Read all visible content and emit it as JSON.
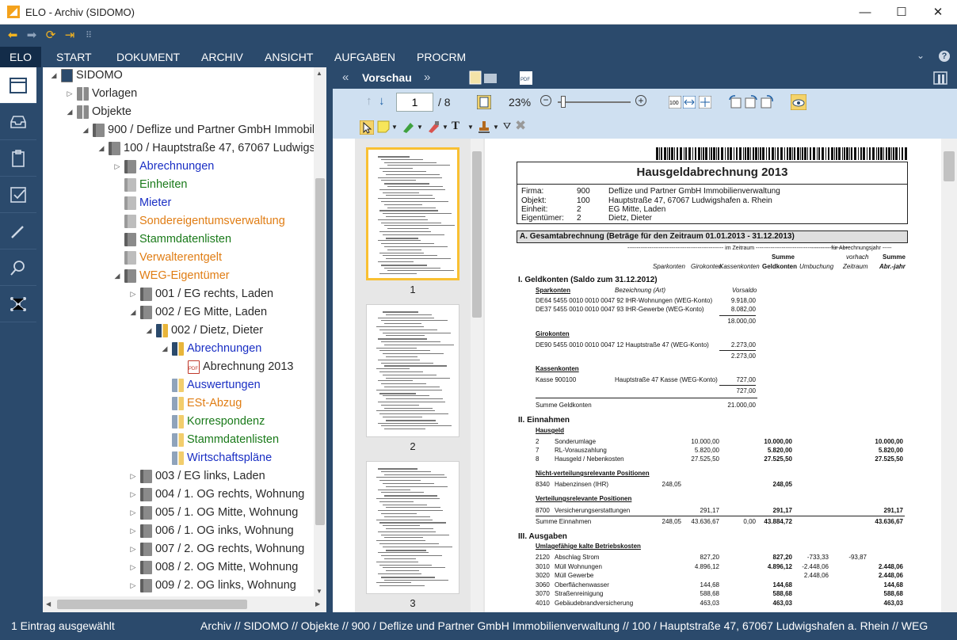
{
  "window": {
    "title": "ELO - Archiv (SIDOMO)",
    "controls": [
      "—",
      "☐",
      "✕"
    ]
  },
  "menu": {
    "logo": "ELO",
    "items": [
      "START",
      "DOKUMENT",
      "ARCHIV",
      "ANSICHT",
      "AUFGABEN",
      "PROCRM"
    ]
  },
  "tree": {
    "items": [
      {
        "label": "SIDOMO",
        "color": "dark",
        "depth": 0,
        "exp": "◢",
        "icon": "archive"
      },
      {
        "label": "Vorlagen",
        "color": "dark",
        "depth": 1,
        "exp": "▷",
        "icon": "cabinet"
      },
      {
        "label": "Objekte",
        "color": "dark",
        "depth": 1,
        "exp": "◢",
        "icon": "cabinet"
      },
      {
        "label": "900 / Deflize und Partner GmbH Immobilie",
        "color": "dark",
        "depth": 2,
        "exp": "◢",
        "icon": "folder-gray"
      },
      {
        "label": "100 / Hauptstraße 47, 67067 Ludwigs",
        "color": "dark",
        "depth": 3,
        "exp": "◢",
        "icon": "folder-gray"
      },
      {
        "label": "Abrechnungen",
        "color": "blue",
        "depth": 4,
        "exp": "▷",
        "icon": "folder-gray"
      },
      {
        "label": "Einheiten",
        "color": "green",
        "depth": 4,
        "exp": "",
        "icon": "folder-light"
      },
      {
        "label": "Mieter",
        "color": "blue",
        "depth": 4,
        "exp": "",
        "icon": "folder-light"
      },
      {
        "label": "Sondereigentumsverwaltung",
        "color": "orange",
        "depth": 4,
        "exp": "",
        "icon": "folder-light"
      },
      {
        "label": "Stammdatenlisten",
        "color": "green",
        "depth": 4,
        "exp": "",
        "icon": "folder-gray"
      },
      {
        "label": "Verwalterentgelt",
        "color": "orange",
        "depth": 4,
        "exp": "",
        "icon": "folder-light"
      },
      {
        "label": "WEG-Eigentümer",
        "color": "orange",
        "depth": 4,
        "exp": "◢",
        "icon": "folder-gray"
      },
      {
        "label": "001 / EG rechts, Laden",
        "color": "dark",
        "depth": 5,
        "exp": "▷",
        "icon": "folder-gray"
      },
      {
        "label": "002 / EG Mitte, Laden",
        "color": "dark",
        "depth": 5,
        "exp": "◢",
        "icon": "folder-gray"
      },
      {
        "label": "002 / Dietz, Dieter",
        "color": "dark",
        "depth": 6,
        "exp": "◢",
        "icon": "binder"
      },
      {
        "label": "Abrechnungen",
        "color": "blue",
        "depth": 7,
        "exp": "◢",
        "icon": "binder"
      },
      {
        "label": "Abrechnung 2013",
        "color": "dark",
        "depth": 8,
        "exp": "",
        "icon": "pdf"
      },
      {
        "label": "Auswertungen",
        "color": "blue",
        "depth": 7,
        "exp": "",
        "icon": "binder-light"
      },
      {
        "label": "ESt-Abzug",
        "color": "orange",
        "depth": 7,
        "exp": "",
        "icon": "binder-light"
      },
      {
        "label": "Korrespondenz",
        "color": "green",
        "depth": 7,
        "exp": "",
        "icon": "binder-light"
      },
      {
        "label": "Stammdatenlisten",
        "color": "green",
        "depth": 7,
        "exp": "",
        "icon": "binder-light"
      },
      {
        "label": "Wirtschaftspläne",
        "color": "blue",
        "depth": 7,
        "exp": "",
        "icon": "binder-light"
      },
      {
        "label": "003 / EG links, Laden",
        "color": "dark",
        "depth": 5,
        "exp": "▷",
        "icon": "folder-gray"
      },
      {
        "label": "004 / 1. OG rechts, Wohnung",
        "color": "dark",
        "depth": 5,
        "exp": "▷",
        "icon": "folder-gray"
      },
      {
        "label": "005 / 1. OG Mitte, Wohnung",
        "color": "dark",
        "depth": 5,
        "exp": "▷",
        "icon": "folder-gray"
      },
      {
        "label": "006 / 1. OG inks, Wohnung",
        "color": "dark",
        "depth": 5,
        "exp": "▷",
        "icon": "folder-gray"
      },
      {
        "label": "007 / 2. OG rechts, Wohnung",
        "color": "dark",
        "depth": 5,
        "exp": "▷",
        "icon": "folder-gray"
      },
      {
        "label": "008 / 2. OG Mitte, Wohnung",
        "color": "dark",
        "depth": 5,
        "exp": "▷",
        "icon": "folder-gray"
      },
      {
        "label": "009 / 2. OG links, Wohnung",
        "color": "dark",
        "depth": 5,
        "exp": "▷",
        "icon": "folder-gray"
      }
    ]
  },
  "preview": {
    "title": "Vorschau",
    "prev": "«",
    "next": "»",
    "page_input": "1",
    "page_total": "/ 8",
    "zoom": "23%",
    "zoom_fraction": 0.08,
    "thumb_labels": [
      "1",
      "2",
      "3"
    ]
  },
  "doc": {
    "title": "Hausgeldabrechnung 2013",
    "info": [
      [
        "Firma:",
        "900",
        "Deflize und Partner GmbH Immobilienverwaltung"
      ],
      [
        "Objekt:",
        "100",
        "Hauptstraße 47, 67067 Ludwigshafen a. Rhein"
      ],
      [
        "Einheit:",
        "2",
        "EG Mitte, Laden"
      ],
      [
        "Eigentümer:",
        "2",
        "Dietz, Dieter"
      ]
    ],
    "section_a": "A.     Gesamtabrechnung (Beträge für den Zeitraum 01.01.2013 - 31.12.2013)",
    "im_zeitraum": "---------------------------------------------------- im Zeitraum --------------------------------------------------",
    "fuer_jahr": "---------- für Abrechnungsjahr -----",
    "col_summe": "Summe",
    "col_vorhach": "vorhach",
    "col_summe2": "Summe",
    "col_spark": "Sparkonten",
    "col_giro": "Girokonten",
    "col_kasse": "Kassenkonten",
    "col_geld": "Geldkonten",
    "col_umb": "Umbuchung",
    "col_zeit": "Zeitraum",
    "col_abr": "Abr.-jahr",
    "s1": "I.      Geldkonten (Saldo zum 31.12.2012)",
    "sparkonten": "Sparkonten",
    "bezeichnung": "Bezeichnung (Art)",
    "vorsaldo": "Vorsaldo",
    "spark_rows": [
      [
        "DE64 5455 0010 0010 0047 92 IHR-Wohnungen (WEG-Konto)",
        "9.918,00"
      ],
      [
        "DE37 5455 0010 0010 0047 93 IHR-Gewerbe (WEG-Konto)",
        "8.082,00"
      ]
    ],
    "spark_sum": "18.000,00",
    "girokonten": "Girokonten",
    "giro_row": [
      "DE90 5455 0010 0010 0047 12 Hauptstraße 47 (WEG-Konto)",
      "2.273,00"
    ],
    "giro_sum": "2.273,00",
    "kassenkonten": "Kassenkonten",
    "kasse_row": [
      "Kasse 900100",
      "Hauptstraße 47 Kasse (WEG-Konto)",
      "727,00"
    ],
    "kasse_sum": "727,00",
    "summe_geld": "Summe Geldkonten",
    "summe_geld_val": "21.000,00",
    "s2": "II.     Einnahmen",
    "hausgeld": "Hausgeld",
    "ein_rows": [
      [
        "2",
        "Sonderumlage",
        "10.000,00",
        "10.000,00",
        "10.000,00"
      ],
      [
        "7",
        "RL-Vorauszahlung",
        "5.820,00",
        "5.820,00",
        "5.820,00"
      ],
      [
        "8",
        "Hausgeld / Nebenkosten",
        "27.525,50",
        "27.525,50",
        "27.525,50"
      ]
    ],
    "nicht_vert": "Nicht-verteilungsrelevante Positionen",
    "haben_row": [
      "8340",
      "Habenzinsen (IHR)",
      "248,05",
      "248,05"
    ],
    "vert": "Verteilungsrelevante Positionen",
    "vers_row": [
      "8700",
      "Versicherungserstattungen",
      "291,17",
      "291,17",
      "291,17"
    ],
    "summe_ein": [
      "Summe Einnahmen",
      "248,05",
      "43.636,67",
      "0,00",
      "43.884,72",
      "43.636,67"
    ],
    "s3": "III.    Ausgaben",
    "umlage": "Umlagefähige kalte Betriebskosten",
    "aus_rows": [
      [
        "2120",
        "Abschlag Strom",
        "827,20",
        "827,20",
        "-733,33",
        "-93,87",
        ""
      ],
      [
        "3010",
        "Müll Wohnungen",
        "4.896,12",
        "4.896,12",
        "-2.448,06",
        "",
        "2.448,06"
      ],
      [
        "3020",
        "Müll Gewerbe",
        "",
        "",
        "2.448,06",
        "",
        "2.448,06"
      ],
      [
        "3060",
        "Oberflächenwasser",
        "144,68",
        "144,68",
        "",
        "",
        "144,68"
      ],
      [
        "3070",
        "Straßenreinigung",
        "588,68",
        "588,68",
        "",
        "",
        "588,68"
      ],
      [
        "4010",
        "Gebäudebrandversicherung",
        "463,03",
        "463,03",
        "",
        "",
        "463,03"
      ]
    ]
  },
  "status": {
    "left": "1 Eintrag ausgewählt",
    "path": "Archiv // SIDOMO // Objekte // 900 / Deflize und Partner GmbH Immobilienverwaltung // 100 / Hauptstraße 47, 67067 Ludwigshafen a. Rhein // WEG"
  }
}
